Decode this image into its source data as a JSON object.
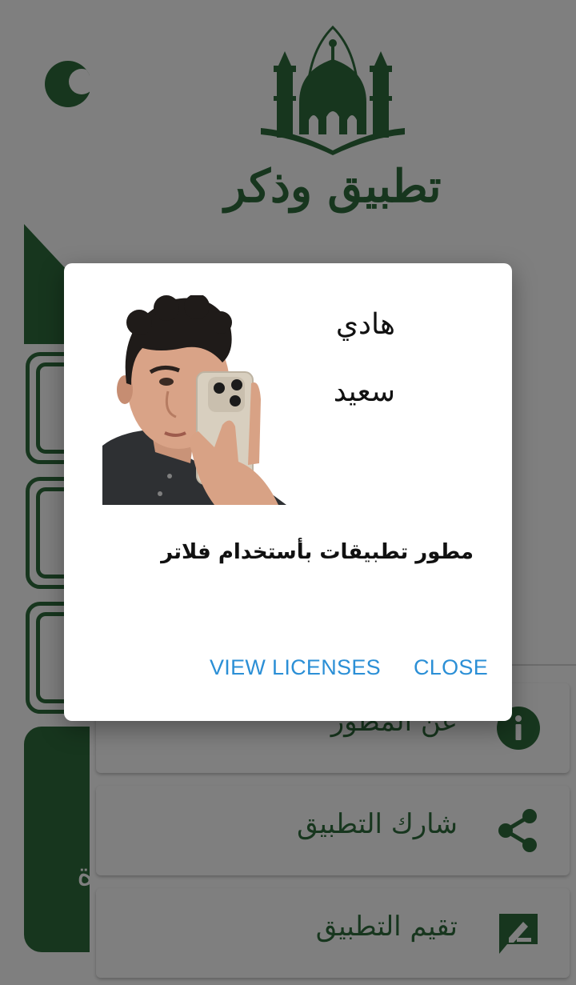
{
  "app": {
    "title": "تطبيق وذكر"
  },
  "drawer": {
    "items": [
      {
        "label": "عن المطور",
        "icon": "info-icon"
      },
      {
        "label": "شارك التطبيق",
        "icon": "share-icon"
      },
      {
        "label": "تقيم التطبيق",
        "icon": "rate-review-icon"
      }
    ]
  },
  "dialog": {
    "first_name": "هادي",
    "last_name": "سعيد",
    "role": "مطور تطبيقات بأستخدام فلاتر",
    "view_licenses_label": "VIEW LICENSES",
    "close_label": "CLOSE"
  },
  "colors": {
    "brand_green": "#2f6d3c",
    "button_blue": "#2b8fd6",
    "scrim": "rgba(0,0,0,0.5)"
  }
}
